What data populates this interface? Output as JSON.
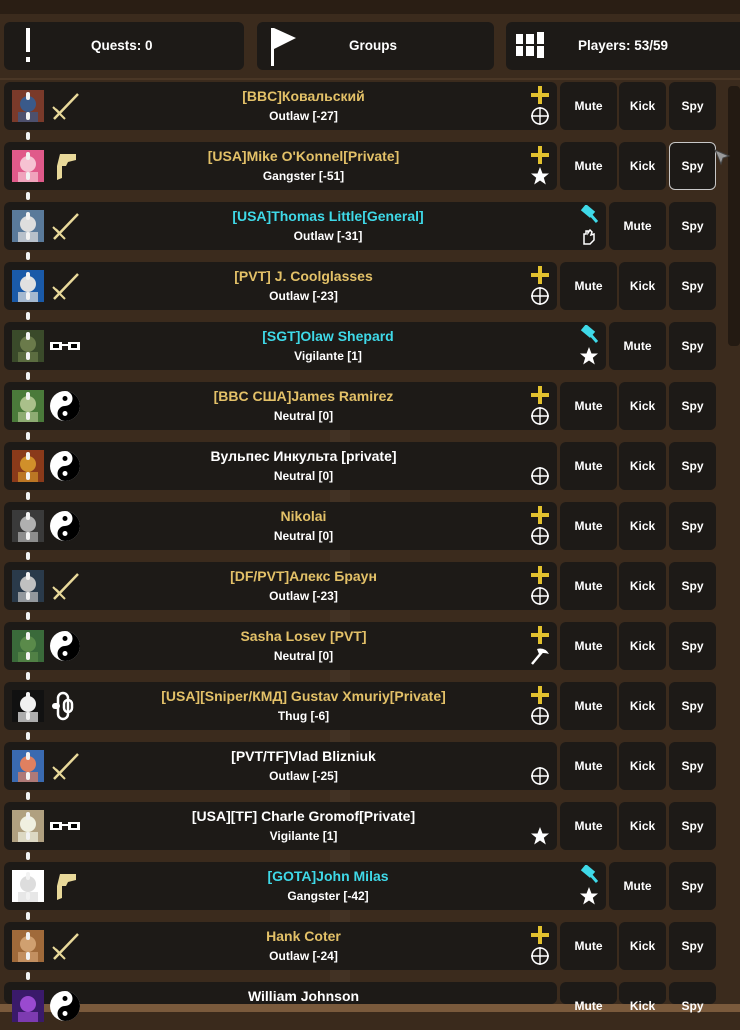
{
  "header": {
    "quests_label": "Quests: 0",
    "groups_label": "Groups",
    "players_label": "Players: 53/59"
  },
  "actions": {
    "mute": "Mute",
    "kick": "Kick",
    "spy": "Spy"
  },
  "players": [
    {
      "name": "[BBC]Ковальский",
      "status": "Outlaw [-27]",
      "name_color": "gold",
      "class_icon": "sword-icon",
      "icon_top": "plus-icon",
      "icon_bottom": "crosshair-icon",
      "kick": true
    },
    {
      "name": "[USA]Mike O'Konnel[Private]",
      "status": "Gangster [-51]",
      "name_color": "gold",
      "class_icon": "gun-icon",
      "icon_top": "plus-icon",
      "icon_bottom": "star-icon",
      "kick": true
    },
    {
      "name": "[USA]Thomas Little[General]",
      "status": "Outlaw [-31]",
      "name_color": "cyan",
      "class_icon": "sword-icon",
      "icon_top": "hammer-icon",
      "icon_bottom": "hand-icon",
      "kick": false
    },
    {
      "name": "[PVT] J. Coolglasses",
      "status": "Outlaw [-23]",
      "name_color": "gold",
      "class_icon": "sword-icon",
      "icon_top": "plus-icon",
      "icon_bottom": "crosshair-icon",
      "kick": true
    },
    {
      "name": "[SGT]Olaw Shepard",
      "status": "Vigilante [1]",
      "name_color": "cyan",
      "class_icon": "glasses-icon",
      "icon_top": "hammer-icon",
      "icon_bottom": "star-icon",
      "kick": false
    },
    {
      "name": "[BBC США]James Ramirez",
      "status": "Neutral [0]",
      "name_color": "gold",
      "class_icon": "yinyang-icon",
      "icon_top": "plus-icon",
      "icon_bottom": "crosshair-icon",
      "kick": true
    },
    {
      "name": "Вульпес Инкульта [private]",
      "status": "Neutral [0]",
      "name_color": "white",
      "class_icon": "yinyang-icon",
      "icon_top": "",
      "icon_bottom": "crosshair-icon",
      "kick": true
    },
    {
      "name": "Nikolai",
      "status": "Neutral [0]",
      "name_color": "gold",
      "class_icon": "yinyang-icon",
      "icon_top": "plus-icon",
      "icon_bottom": "crosshair-icon",
      "kick": true
    },
    {
      "name": "[DF/PVT]Алекс Браун",
      "status": "Outlaw [-23]",
      "name_color": "gold",
      "class_icon": "sword-icon",
      "icon_top": "plus-icon",
      "icon_bottom": "crosshair-icon",
      "kick": true
    },
    {
      "name": "Sasha Losev [PVT]",
      "status": "Neutral [0]",
      "name_color": "gold",
      "class_icon": "yinyang-icon",
      "icon_top": "plus-icon",
      "icon_bottom": "pickaxe-icon",
      "kick": true
    },
    {
      "name": "[USA][Sniper/КМД] Gustav Xmuriy[Private]",
      "status": "Thug [-6]",
      "name_color": "gold",
      "class_icon": "chain-icon",
      "icon_top": "plus-icon",
      "icon_bottom": "crosshair-icon",
      "kick": true
    },
    {
      "name": "[PVT/TF]Vlad Blizniuk",
      "status": "Outlaw [-25]",
      "name_color": "white",
      "class_icon": "sword-icon",
      "icon_top": "",
      "icon_bottom": "crosshair-icon",
      "kick": true
    },
    {
      "name": "[USA][TF] Charle Gromof[Private]",
      "status": "Vigilante [1]",
      "name_color": "white",
      "class_icon": "glasses-icon",
      "icon_top": "",
      "icon_bottom": "star-icon",
      "kick": true
    },
    {
      "name": "[GOTA]John Milas",
      "status": "Gangster [-42]",
      "name_color": "cyan",
      "class_icon": "gun-icon",
      "icon_top": "hammer-icon",
      "icon_bottom": "star-icon",
      "kick": false
    },
    {
      "name": "Hank Coter",
      "status": "Outlaw [-24]",
      "name_color": "gold",
      "class_icon": "sword-icon",
      "icon_top": "plus-icon",
      "icon_bottom": "crosshair-icon",
      "kick": true
    },
    {
      "name": "William Johnson",
      "status": "",
      "name_color": "white",
      "class_icon": "yinyang-icon",
      "icon_top": "",
      "icon_bottom": "",
      "kick": true
    }
  ],
  "colors": {
    "gold": "#e3c168",
    "cyan": "#3fd9e8",
    "white": "#ffffff",
    "panel": "#1d1a17",
    "wood": "#3a2a1c"
  }
}
